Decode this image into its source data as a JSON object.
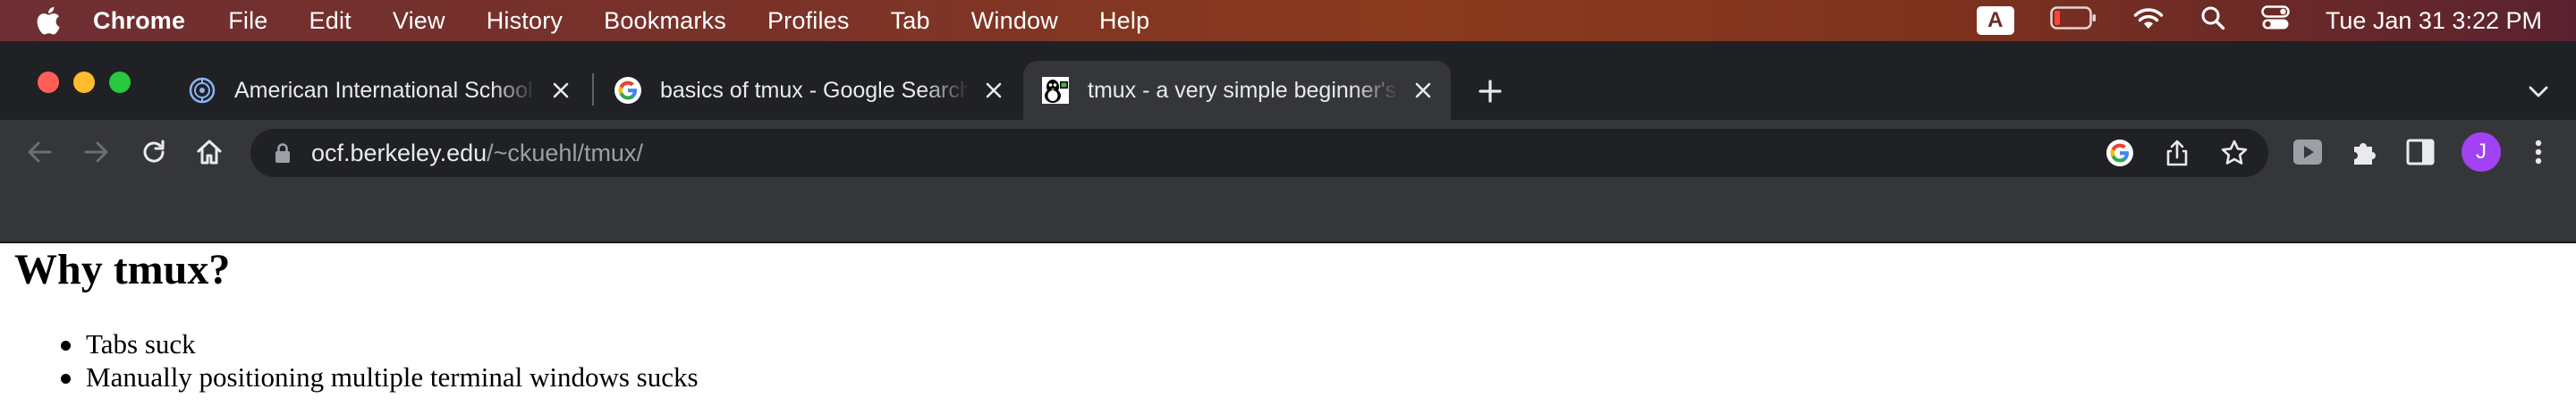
{
  "menubar": {
    "app_name": "Chrome",
    "items": [
      "File",
      "Edit",
      "View",
      "History",
      "Bookmarks",
      "Profiles",
      "Tab",
      "Window",
      "Help"
    ],
    "input_badge": "A",
    "clock": "Tue Jan 31  3:22 PM",
    "icons": [
      "apple-icon",
      "battery-icon",
      "wifi-icon",
      "spotlight-search-icon",
      "control-center-icon"
    ]
  },
  "tabs": [
    {
      "title": "American International School of",
      "favicon": "school-icon",
      "active": false
    },
    {
      "title": "basics of tmux - Google Search",
      "favicon": "google-icon",
      "active": false
    },
    {
      "title": "tmux - a very simple beginner's",
      "favicon": "penguin-icon",
      "active": true
    }
  ],
  "toolbar": {
    "url_host": "ocf.berkeley.edu",
    "url_path": "/~ckuehl/tmux/",
    "profile_initial": "J",
    "icons": [
      "back-icon",
      "forward-icon",
      "reload-icon",
      "home-icon",
      "lock-icon",
      "google-lens-icon",
      "share-icon",
      "bookmark-star-icon",
      "extension-icon",
      "puzzle-icon",
      "side-panel-icon",
      "more-icon"
    ]
  },
  "page": {
    "heading": "Why tmux?",
    "bullets": [
      "Tabs suck",
      "Manually positioning multiple terminal windows sucks"
    ]
  },
  "colors": {
    "tab_strip": "#202124",
    "toolbar": "#35363a",
    "avatar": "#a142f4",
    "close_red": "#ff5f57",
    "minimize_yellow": "#febc2e",
    "zoom_green": "#28c840"
  }
}
